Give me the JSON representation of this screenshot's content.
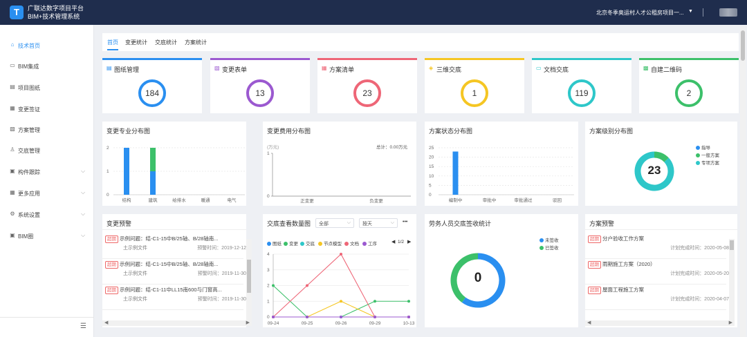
{
  "app": {
    "logo_letter": "T",
    "title_line1": "广联达数字项目平台",
    "title_line2": "BIM+技术管理系统",
    "project": "北京冬季奥运村人才公租房项目一..."
  },
  "sidebar": {
    "items": [
      {
        "label": "技术首页",
        "icon": "home-icon",
        "active": true,
        "chev": false
      },
      {
        "label": "BIM集成",
        "icon": "monitor-icon",
        "active": false,
        "chev": false
      },
      {
        "label": "项目图纸",
        "icon": "drawing-icon",
        "active": false,
        "chev": false
      },
      {
        "label": "变更签证",
        "icon": "document-icon",
        "active": false,
        "chev": false
      },
      {
        "label": "方案管理",
        "icon": "plan-icon",
        "active": false,
        "chev": false
      },
      {
        "label": "交底管理",
        "icon": "person-icon",
        "active": false,
        "chev": false
      },
      {
        "label": "构件跟踪",
        "icon": "component-icon",
        "active": false,
        "chev": true
      },
      {
        "label": "更多应用",
        "icon": "grid-icon",
        "active": false,
        "chev": true
      },
      {
        "label": "系统设置",
        "icon": "gear-icon",
        "active": false,
        "chev": true
      },
      {
        "label": "BIM圈",
        "icon": "circle-icon",
        "active": false,
        "chev": true
      }
    ]
  },
  "tabs": [
    "首页",
    "变更统计",
    "交底统计",
    "方案统计"
  ],
  "stats": [
    {
      "name": "图纸管理",
      "value": "184",
      "color": "#2a8ff0",
      "icon": "drawing-icon"
    },
    {
      "name": "变更表单",
      "value": "13",
      "color": "#9b59d0",
      "icon": "form-icon"
    },
    {
      "name": "方案清单",
      "value": "23",
      "color": "#ee6677",
      "icon": "list-icon"
    },
    {
      "name": "三维交底",
      "value": "1",
      "color": "#f5c623",
      "icon": "cube-icon"
    },
    {
      "name": "文档交底",
      "value": "119",
      "color": "#2ec7c9",
      "icon": "doc-icon"
    },
    {
      "name": "自建二维码",
      "value": "2",
      "color": "#3cc06a",
      "icon": "qrcode-icon"
    }
  ],
  "panels": {
    "change_major": {
      "title": "变更专业分布图"
    },
    "change_cost": {
      "title": "变更费用分布图",
      "unit": "(万元)",
      "total": "总计：0.00万元"
    },
    "plan_status": {
      "title": "方案状态分布图"
    },
    "plan_level": {
      "title": "方案级别分布图",
      "center": "23",
      "legend": [
        {
          "name": "指导",
          "color": "#2a8ff0"
        },
        {
          "name": "一般方案",
          "color": "#3cc06a"
        },
        {
          "name": "专项方案",
          "color": "#2ec7c9"
        }
      ]
    },
    "change_warning": {
      "title": "变更预警",
      "tag": "超期",
      "items": [
        {
          "text": "示例问题：结-C1-15中B/25轴、B/28轴南...",
          "sub": "土示例文件",
          "time": "预警时间：2019-12-12"
        },
        {
          "text": "示例问题：结-C1-15中B/25轴、B/28轴南...",
          "sub": "土示例文件",
          "time": "预警时间：2019-11-30"
        },
        {
          "text": "示例问题：结-C1-11中LL15南600与门窗高...",
          "sub": "土示例文件",
          "time": "预警时间：2019-11-30"
        }
      ]
    },
    "disclosure_views": {
      "title": "交底查看数量图",
      "select1": "全部",
      "select2": "按天",
      "more": "•••",
      "page": "1/2",
      "legend": [
        {
          "name": "图纸",
          "color": "#2a8ff0"
        },
        {
          "name": "变更",
          "color": "#3cc06a"
        },
        {
          "name": "交底",
          "color": "#2ec7c9"
        },
        {
          "name": "节点模型",
          "color": "#f5c623"
        },
        {
          "name": "文档",
          "color": "#ee6677"
        },
        {
          "name": "工序",
          "color": "#9b59d0"
        }
      ]
    },
    "labor": {
      "title": "劳务人员交底签收统计",
      "center": "0",
      "legend": [
        {
          "name": "未签收",
          "color": "#2a8ff0"
        },
        {
          "name": "已签收",
          "color": "#3cc06a"
        }
      ]
    },
    "plan_warning": {
      "title": "方案预警",
      "tag": "超期",
      "items": [
        {
          "text": "分户验收工作方案",
          "time": "计划完成时间：2020-05-08"
        },
        {
          "text": "雨期施工方案（2020）",
          "time": "计划完成时间：2020-05-20"
        },
        {
          "text": "屋面工程施工方案",
          "time": "计划完成时间：2020-04-07"
        }
      ]
    }
  },
  "chart_data": [
    {
      "type": "bar",
      "title": "变更专业分布图",
      "categories": [
        "结构",
        "建筑",
        "给排水",
        "暖通",
        "电气"
      ],
      "series": [
        {
          "values": [
            2,
            1,
            0,
            0,
            0
          ],
          "color": "#2a8ff0"
        },
        {
          "values": [
            0,
            1,
            0,
            0,
            0
          ],
          "color": "#3cc06a"
        }
      ],
      "stacked": true,
      "yticks": [
        "0",
        "1",
        "2"
      ],
      "ylim": [
        0,
        2
      ]
    },
    {
      "type": "bar",
      "title": "变更费用分布图",
      "categories": [
        "正变更",
        "负变更"
      ],
      "values": [
        0,
        0
      ],
      "yticks": [
        "0",
        "1"
      ],
      "ylim": [
        0,
        1
      ]
    },
    {
      "type": "bar",
      "title": "方案状态分布图",
      "categories": [
        "编制中",
        "审批中",
        "审批通过",
        "驳回"
      ],
      "values": [
        23,
        0,
        0,
        0
      ],
      "color": "#2a8ff0",
      "yticks": [
        "0",
        "5",
        "10",
        "15",
        "20",
        "25"
      ],
      "ylim": [
        0,
        25
      ]
    },
    {
      "type": "pie",
      "title": "方案级别分布图",
      "labels": [
        "指导",
        "一般方案",
        "专项方案"
      ],
      "values": [
        0,
        3,
        20
      ]
    },
    {
      "type": "line",
      "title": "交底查看数量图",
      "x": [
        "09-24",
        "09-25",
        "09-26",
        "09-29",
        "10-13"
      ],
      "yticks": [
        "0",
        "1",
        "2",
        "3",
        "4"
      ],
      "ylim": [
        0,
        4
      ],
      "series": [
        {
          "name": "图纸",
          "color": "#2a8ff0",
          "values": [
            0,
            0,
            0,
            0,
            0
          ]
        },
        {
          "name": "变更",
          "color": "#3cc06a",
          "values": [
            2,
            0,
            0,
            1,
            1
          ]
        },
        {
          "name": "交底",
          "color": "#2ec7c9",
          "values": [
            0,
            0,
            0,
            0,
            0
          ]
        },
        {
          "name": "节点模型",
          "color": "#f5c623",
          "values": [
            0,
            0,
            1,
            0,
            0
          ]
        },
        {
          "name": "文档",
          "color": "#ee6677",
          "values": [
            0,
            2,
            4,
            0,
            0
          ]
        },
        {
          "name": "工序",
          "color": "#9b59d0",
          "values": [
            0,
            0,
            0,
            0,
            0
          ]
        }
      ]
    },
    {
      "type": "pie",
      "title": "劳务人员交底签收统计",
      "labels": [
        "未签收",
        "已签收"
      ],
      "values": [
        0.6,
        0.4
      ]
    }
  ]
}
